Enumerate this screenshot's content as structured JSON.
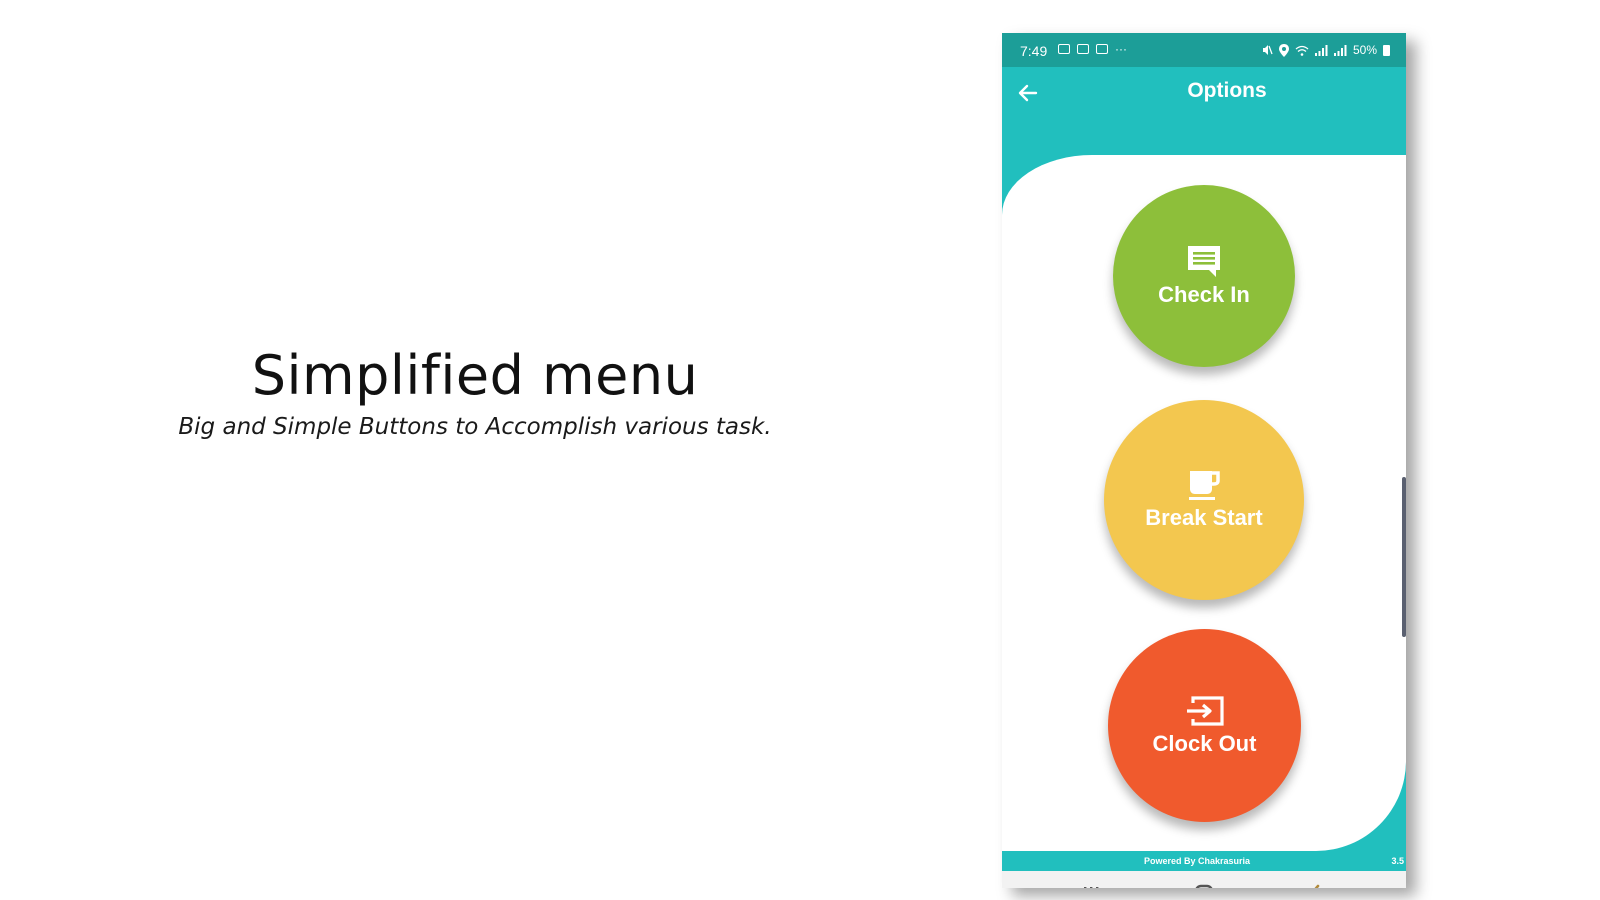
{
  "slide": {
    "headline": "Simplified menu",
    "subline": "Big and Simple Buttons to Accomplish various task."
  },
  "status_bar": {
    "time": "7:49",
    "more": "···",
    "battery": "50%"
  },
  "app_bar": {
    "title": "Options",
    "back_icon": "arrow-left-icon"
  },
  "buttons": [
    {
      "label": "Check In",
      "color": "#8dbf3a",
      "icon": "chat-icon"
    },
    {
      "label": "Break Start",
      "color": "#f3c74f",
      "icon": "coffee-cup-icon"
    },
    {
      "label": "Clock Out",
      "color": "#f05a2d",
      "icon": "exit-icon"
    }
  ],
  "footer": {
    "powered_by": "Powered By Chakrasuria",
    "version": "3.5"
  },
  "nav_bar": {
    "recents_icon": "recents-icon",
    "home_icon": "home-icon",
    "back_icon": "back-chevron-icon"
  },
  "colors": {
    "status_bar": "#1c9e98",
    "app_bar": "#21bfbe",
    "nav_bar": "#f2f2f2"
  }
}
